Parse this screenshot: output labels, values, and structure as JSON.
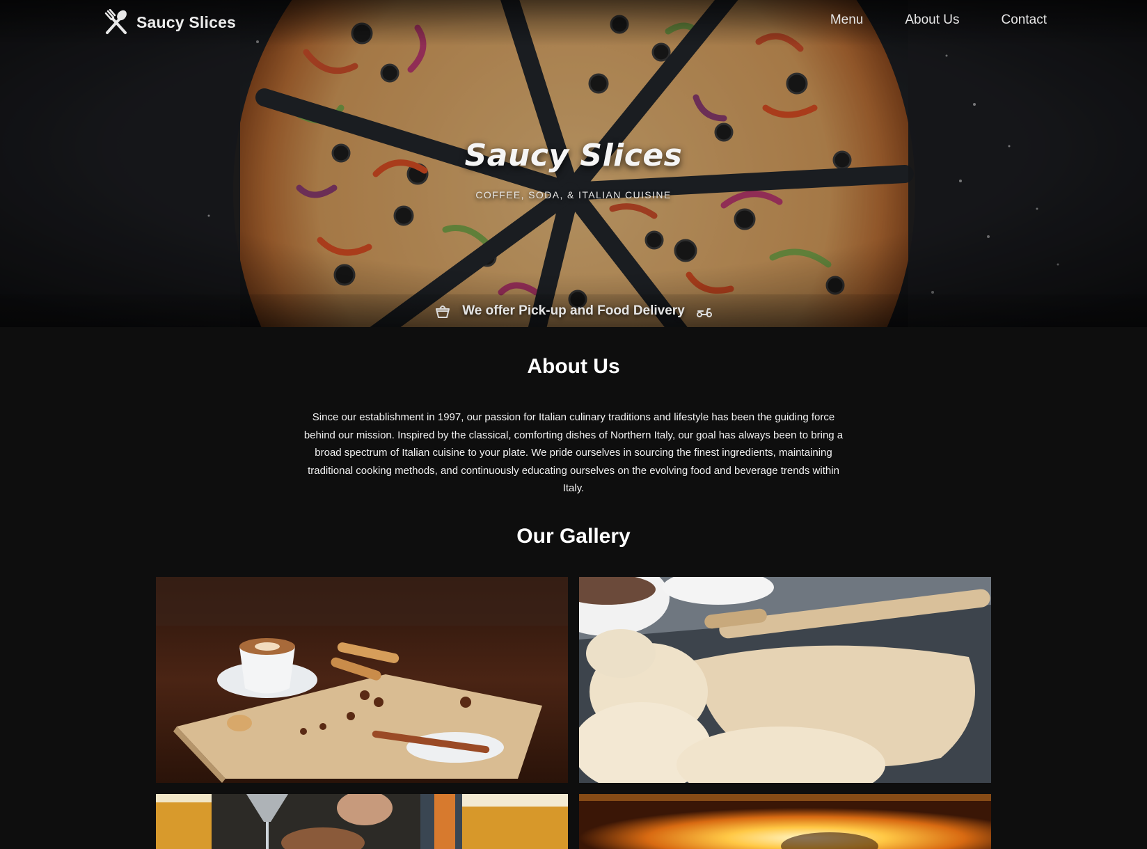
{
  "brand": {
    "name": "Saucy Slices",
    "icon": "fork-spoon-icon"
  },
  "nav": {
    "links": [
      "Menu",
      "About Us",
      "Contact"
    ]
  },
  "hero": {
    "title": "Saucy Slices",
    "subtitle": "COFFEE, SODA, & ITALIAN CUISINE",
    "delivery_text": "We offer Pick-up and Food Delivery",
    "delivery_icons": [
      "shopping-basket-icon",
      "scooter-icon"
    ]
  },
  "about": {
    "title": "About Us",
    "text": "Since our establishment in 1997, our passion for Italian culinary traditions and lifestyle has been the guiding force behind our mission. Inspired by the classical, comforting dishes of Northern Italy, our goal has always been to bring a broad spectrum of Italian cuisine to your plate. We pride ourselves in sourcing the finest ingredients, maintaining traditional cooking methods, and continuously educating ourselves on the evolving food and beverage trends within Italy."
  },
  "gallery": {
    "title": "Our Gallery",
    "images": [
      "coffee-and-spices-photo",
      "pizza-dough-photo",
      "drinks-photo",
      "wood-fired-oven-photo"
    ]
  },
  "colors": {
    "background": "#0e0e0e",
    "text": "#f2f2f2",
    "hero_bg": "#1c1e22"
  }
}
